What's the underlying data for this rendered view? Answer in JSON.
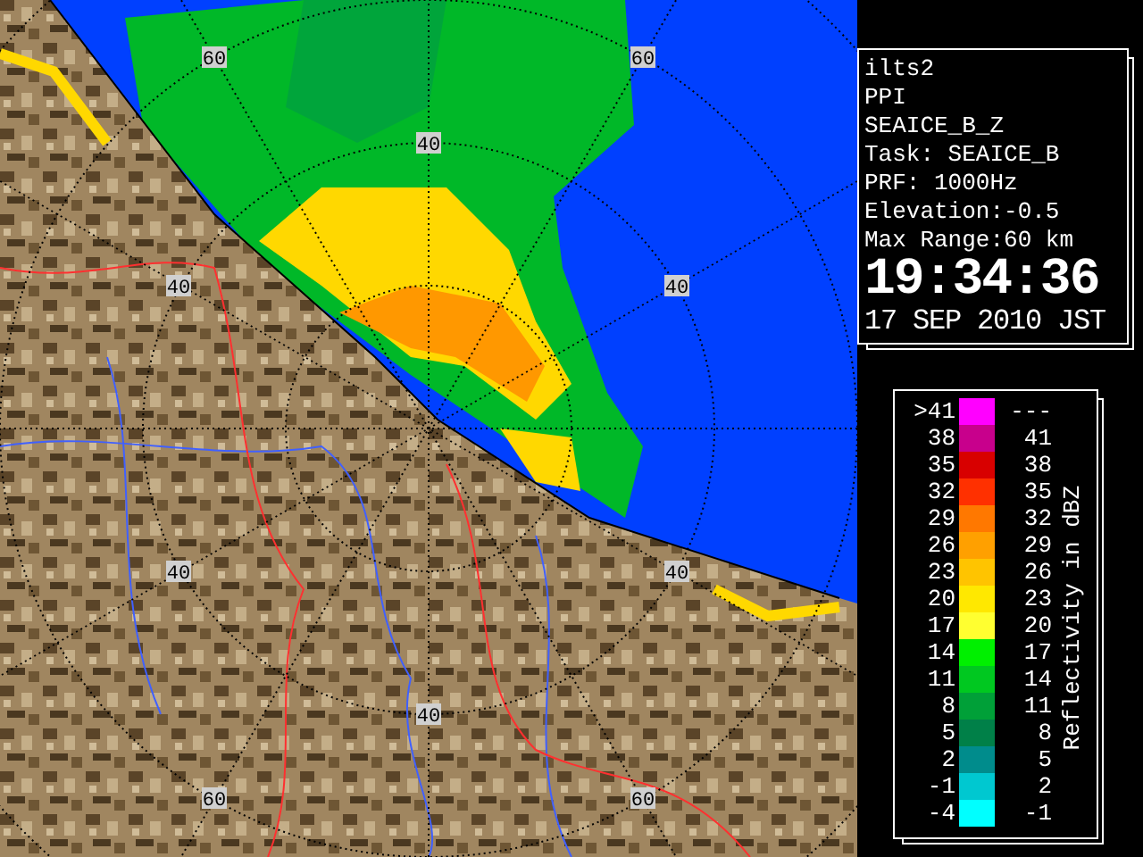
{
  "map": {
    "range_labels": [
      "60",
      "60",
      "40",
      "40",
      "40",
      "40",
      "40",
      "40",
      "60",
      "60"
    ]
  },
  "info": {
    "lines": [
      "ilts2",
      "PPI",
      "SEAICE_B_Z",
      "Task: SEAICE_B",
      "PRF: 1000Hz",
      "Elevation:-0.5",
      "Max Range:60 km"
    ],
    "time": "19:34:36",
    "date": "17 SEP 2010 JST"
  },
  "legend": {
    "title": "Reflectivity in dBZ",
    "rows": [
      {
        "low": ">41",
        "high": "---",
        "color": "#ff00ff"
      },
      {
        "low": "38",
        "high": "41",
        "color": "#c8008c"
      },
      {
        "low": "35",
        "high": "38",
        "color": "#d80000"
      },
      {
        "low": "32",
        "high": "35",
        "color": "#ff3000"
      },
      {
        "low": "29",
        "high": "32",
        "color": "#ff7800"
      },
      {
        "low": "26",
        "high": "29",
        "color": "#ffa000"
      },
      {
        "low": "23",
        "high": "26",
        "color": "#ffc400"
      },
      {
        "low": "20",
        "high": "23",
        "color": "#ffe800"
      },
      {
        "low": "17",
        "high": "20",
        "color": "#ffff30"
      },
      {
        "low": "14",
        "high": "17",
        "color": "#00f000"
      },
      {
        "low": "11",
        "high": "14",
        "color": "#00c820"
      },
      {
        "low": "8",
        "high": "11",
        "color": "#00a038"
      },
      {
        "low": "5",
        "high": "8",
        "color": "#008048"
      },
      {
        "low": "2",
        "high": "5",
        "color": "#008c8c"
      },
      {
        "low": "-1",
        "high": "2",
        "color": "#00c8d0"
      },
      {
        "low": "-4",
        "high": "-1",
        "color": "#00ffff"
      }
    ]
  }
}
